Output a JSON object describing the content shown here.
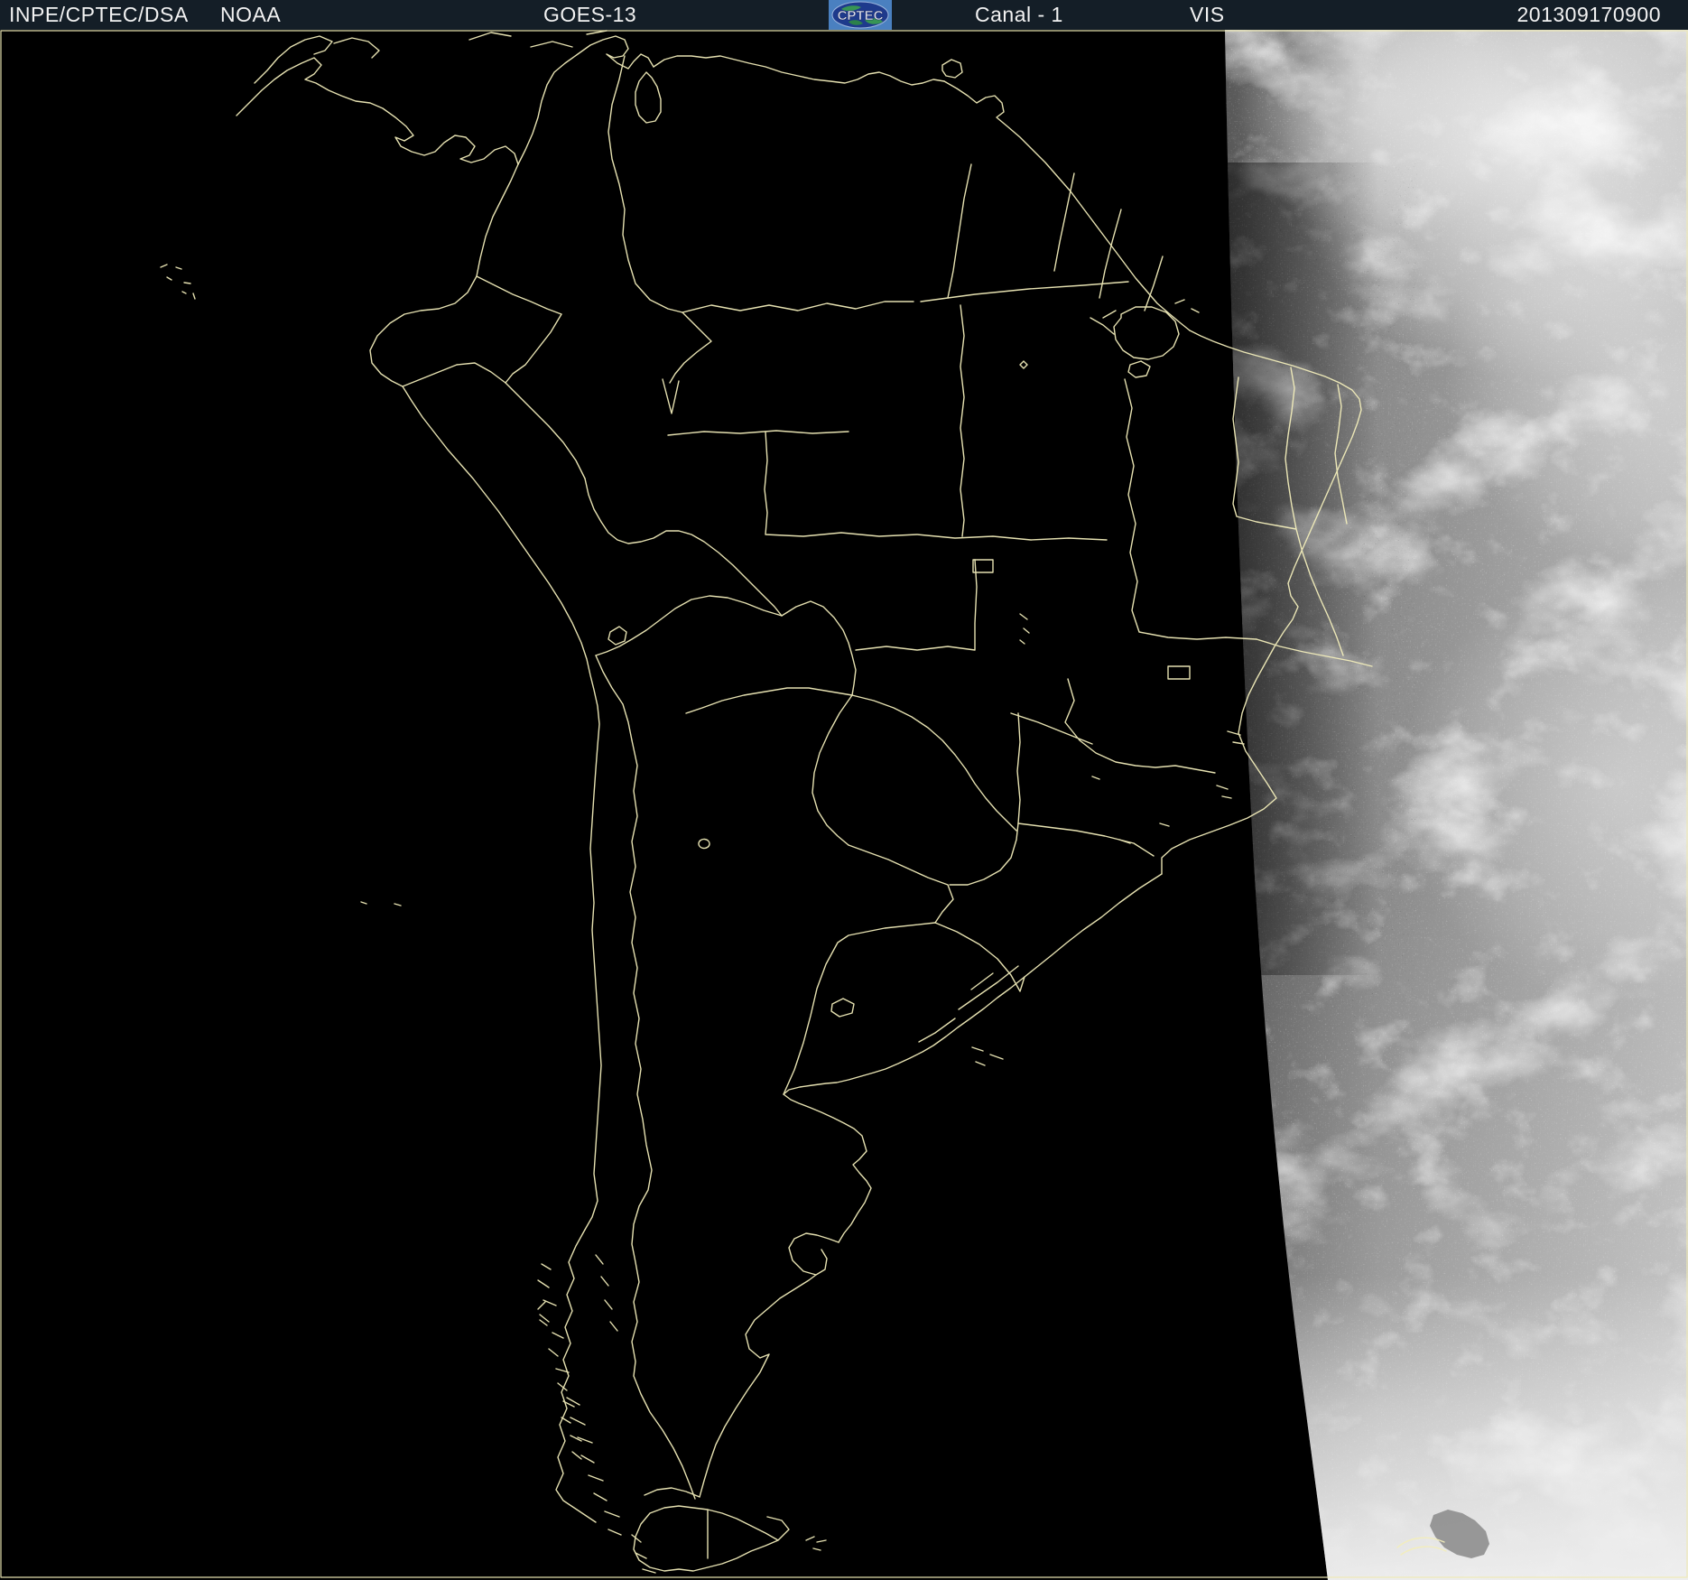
{
  "header": {
    "source": "INPE/CPTEC/DSA",
    "agency": "NOAA",
    "satellite": "GOES-13",
    "channel": "Canal - 1",
    "band": "VIS",
    "timestamp": "201309170900",
    "logo_text": "CPTEC"
  },
  "colors": {
    "header_bg": "#141e27",
    "header_text": "#f2f2f2",
    "map_outline": "#f3eebb",
    "frame_line": "#efeab5",
    "night_side": "#000000",
    "day_side_base": "#8e8e8e",
    "cloud_white": "#f2f2f2",
    "logo_bg": "#4a80c0",
    "logo_oval": "#1e3a8c",
    "logo_land": "#3aa04e",
    "logo_text_color": "#d9dce8"
  }
}
